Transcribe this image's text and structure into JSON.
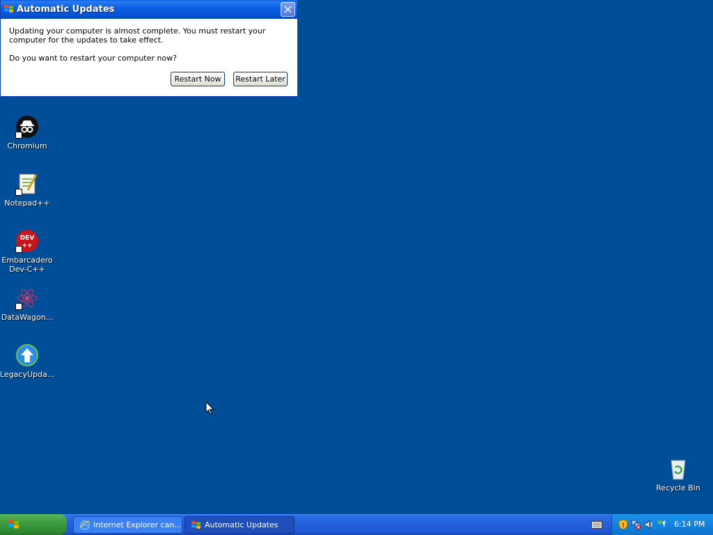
{
  "dialog": {
    "title": "Automatic Updates",
    "message": "Updating your computer is almost complete. You must restart your computer for the updates to take effect.",
    "question": "Do you want to restart your computer now?",
    "restart_now": "Restart Now",
    "restart_later": "Restart Later"
  },
  "desktop_icons": [
    {
      "label": "Chromium"
    },
    {
      "label": "Notepad++"
    },
    {
      "label": "Embarcadero Dev-C++",
      "icon_text": "DEV ++"
    },
    {
      "label": "DataWagon..."
    },
    {
      "label": "LegacyUpda..."
    },
    {
      "label": "Recycle Bin"
    }
  ],
  "taskbar": {
    "tasks": [
      {
        "label": "Internet Explorer can..."
      },
      {
        "label": "Automatic Updates"
      }
    ],
    "clock": "6:14 PM"
  },
  "colors": {
    "desktop": "#004e98",
    "taskbar": "#245edb",
    "start": "#3c9c3e",
    "titlebar": "#0653d6"
  }
}
